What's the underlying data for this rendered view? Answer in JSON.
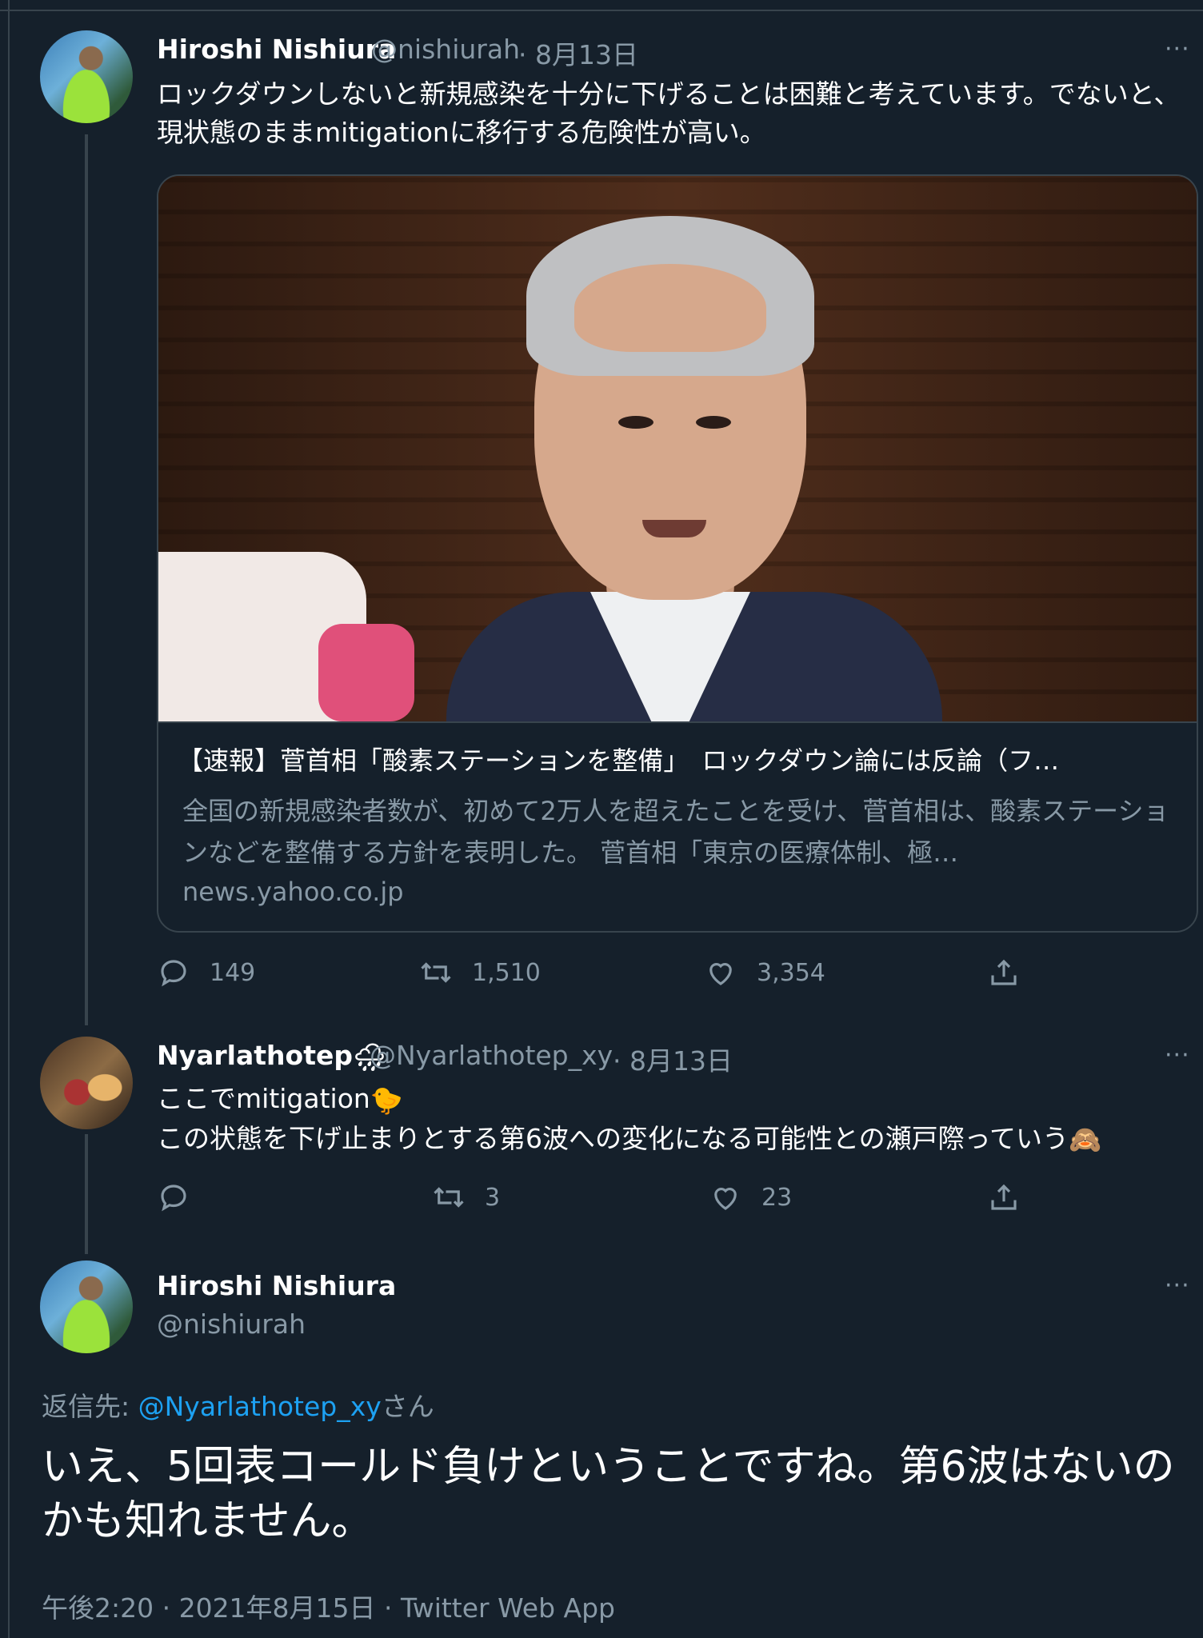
{
  "colors": {
    "background": "#15202b",
    "muted": "#8899a6",
    "link": "#1da1f2",
    "border": "#38444d"
  },
  "tweet1": {
    "name": "Hiroshi Nishiura",
    "handle": "@nishiurah",
    "date": "· 8月13日",
    "more": "···",
    "text": "ロックダウンしないと新規感染を十分に下げることは困難と考えています。でないと、現状態のままmitigationに移行する危険性が高い。",
    "card": {
      "title": "【速報】菅首相「酸素ステーションを整備」　ロックダウン論には反論（フ…",
      "description": "全国の新規感染者数が、初めて2万人を超えたことを受け、菅首相は、酸素ステーションなどを整備する方針を表明した。 菅首相「東京の医療体制、極…",
      "domain": "news.yahoo.co.jp"
    },
    "replies": "149",
    "retweets": "1,510",
    "likes": "3,354"
  },
  "tweet2": {
    "name": "Nyarlathotep",
    "name_emoji": "🌧",
    "handle": "@Nyarlathotep_xy",
    "date": "· 8月13日",
    "more": "···",
    "line1": "ここでmitigation",
    "line1_emoji": "🐤",
    "line2": "この状態を下げ止まりとする第6波への変化になる可能性との瀬戸際っていう",
    "line2_emoji": "🙈",
    "replies": "",
    "retweets": "3",
    "likes": "23"
  },
  "tweet3": {
    "name": "Hiroshi Nishiura",
    "handle": "@nishiurah",
    "more": "···",
    "reply_prefix": "返信先: ",
    "reply_handle": "@Nyarlathotep_xy",
    "reply_suffix": "さん",
    "text": "いえ、5回表コールド負けということですね。第6波はないのかも知れません。",
    "timestamp": "午後2:20 · 2021年8月15日 · Twitter Web App"
  }
}
